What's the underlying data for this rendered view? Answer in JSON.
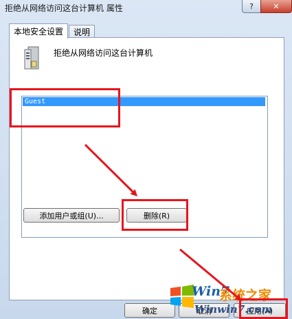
{
  "window": {
    "title": "拒绝从网络访问这台计算机 属性",
    "help_label": "?",
    "close_label": "✕"
  },
  "tabs": [
    {
      "label": "本地安全设置",
      "active": true
    },
    {
      "label": "说明",
      "active": false
    }
  ],
  "policy": {
    "icon": "server-icon",
    "title": "拒绝从网络访问这台计算机"
  },
  "members": {
    "items": [
      "Guest"
    ],
    "selected_index": 0
  },
  "actions": {
    "add_label": "添加用户或组(U)...",
    "remove_label": "删除(R)"
  },
  "footer": {
    "ok_label": "确定",
    "cancel_label": "取消",
    "apply_label": "应用(A)"
  },
  "watermark": {
    "site": "Win7",
    "name": "系统之家",
    "url": "Winwin7.com"
  },
  "colors": {
    "selection": "#3399ff",
    "annotation": "#e8141c",
    "frame": "#c8d8ec"
  }
}
